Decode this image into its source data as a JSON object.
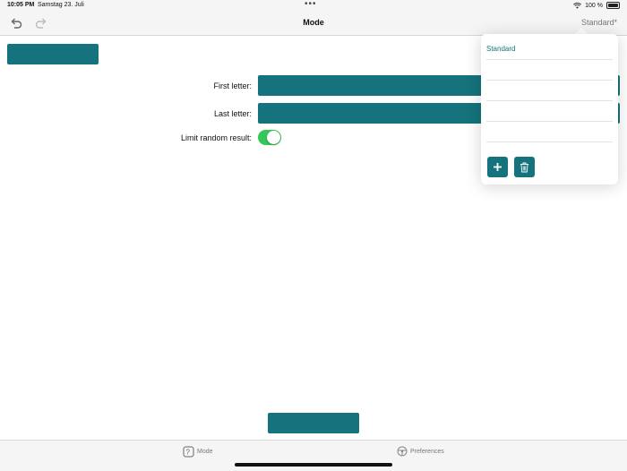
{
  "status_bar": {
    "time": "10:05 PM",
    "date": "Samstag 23. Juli",
    "battery": "100 %"
  },
  "nav_bar": {
    "title": "Mode",
    "profile": "Standard*"
  },
  "form": {
    "first_letter_label": "First letter:",
    "last_letter_label": "Last letter:",
    "limit_label": "Limit random result:",
    "limit_enabled": true
  },
  "popover": {
    "items": [
      "Standard",
      "",
      "",
      "",
      ""
    ]
  },
  "tab_bar": {
    "mode": "Mode",
    "preferences": "Preferences"
  },
  "colors": {
    "accent": "#14737c",
    "toggle_on": "#34c759"
  }
}
